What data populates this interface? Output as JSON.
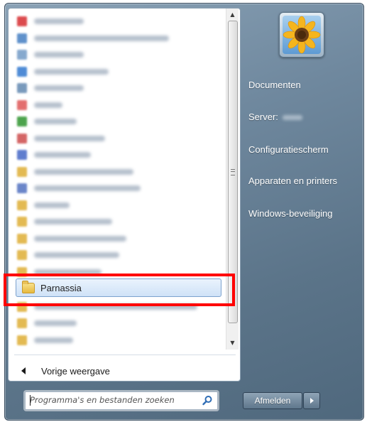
{
  "programs": {
    "items": [
      {
        "icon_color": "#d9383b",
        "label_width": 70
      },
      {
        "icon_color": "#4f86c6",
        "label_width": 190
      },
      {
        "icon_color": "#7aa0c9",
        "label_width": 70
      },
      {
        "icon_color": "#3c7fd2",
        "label_width": 105
      },
      {
        "icon_color": "#6b8fb5",
        "label_width": 70
      },
      {
        "icon_color": "#e06060",
        "label_width": 40
      },
      {
        "icon_color": "#3a9a3a",
        "label_width": 60
      },
      {
        "icon_color": "#d05656",
        "label_width": 100
      },
      {
        "icon_color": "#4e6fc9",
        "label_width": 80
      },
      {
        "icon_color": "#e0b341",
        "label_width": 140
      },
      {
        "icon_color": "#5b79c4",
        "label_width": 150
      },
      {
        "icon_color": "#e0b341",
        "label_width": 50
      },
      {
        "icon_color": "#e0b341",
        "label_width": 110
      },
      {
        "icon_color": "#e0b341",
        "label_width": 130
      },
      {
        "icon_color": "#e0b341",
        "label_width": 120
      },
      {
        "icon_color": "#e0b341",
        "label_width": 95
      }
    ],
    "selected_label": "Parnassia",
    "after_items": [
      {
        "icon_color": "#e0b341",
        "label_width": 230
      },
      {
        "icon_color": "#e0b341",
        "label_width": 60
      },
      {
        "icon_color": "#e0b341",
        "label_width": 55
      }
    ]
  },
  "back_label": "Vorige weergave",
  "search": {
    "placeholder": "Programma's en bestanden zoeken"
  },
  "right_pane": {
    "documenten": "Documenten",
    "server_label": "Server:",
    "configuratiescherm": "Configuratiescherm",
    "apparaten": "Apparaten en printers",
    "beveiliging": "Windows-beveiliging"
  },
  "afmelden_label": "Afmelden",
  "scroll": {
    "up_glyph": "▲",
    "down_glyph": "▼"
  },
  "colors": {
    "highlight": "#ff0000",
    "menu_bg": "#6f889e"
  }
}
